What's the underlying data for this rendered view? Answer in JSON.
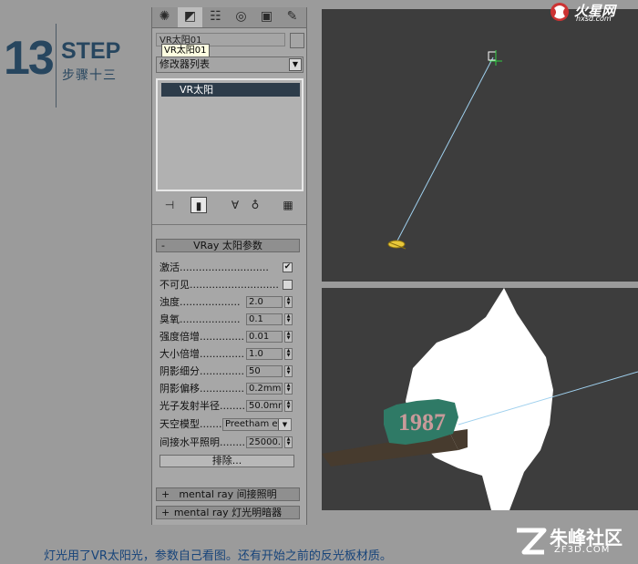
{
  "step": {
    "number": "13",
    "word": "STEP",
    "subtitle": "步骤十三"
  },
  "panel": {
    "tabs": [
      "create-icon",
      "modify-icon",
      "hierarchy-icon",
      "motion-icon",
      "display-icon",
      "utilities-icon"
    ],
    "object_name": "VR太阳01",
    "tooltip": "VR太阳01",
    "modifier_list": "修改器列表",
    "stack_item": "VR太阳",
    "rollout_title": "VRay 太阳参数",
    "params": [
      {
        "label": "激活............................",
        "type": "checkbox",
        "checked": "✔"
      },
      {
        "label": "不可见............................",
        "type": "checkbox",
        "checked": ""
      },
      {
        "label": "浊度...................",
        "type": "spinner",
        "value": "2.0"
      },
      {
        "label": "臭氧...................",
        "type": "spinner",
        "value": "0.1"
      },
      {
        "label": "强度倍增..............",
        "type": "spinner",
        "value": "0.01"
      },
      {
        "label": "大小倍增..............",
        "type": "spinner",
        "value": "1.0"
      },
      {
        "label": "阴影细分..............",
        "type": "spinner",
        "value": "50"
      },
      {
        "label": "阴影偏移..............",
        "type": "spinner",
        "value": "0.2mm"
      },
      {
        "label": "光子发射半径.........",
        "type": "spinner",
        "value": "50.0mm"
      },
      {
        "label": "天空模型.........",
        "type": "select",
        "value": "Preetham et"
      },
      {
        "label": "间接水平照明.........",
        "type": "spinner",
        "value": "25000."
      }
    ],
    "exclude_label": "排除...",
    "rollouts_collapsed": [
      {
        "sign": "+",
        "title": "mental ray 间接照明"
      },
      {
        "sign": "+",
        "title": "mental ray 灯光明暗器"
      }
    ],
    "rollout_sign": "-"
  },
  "logo": {
    "word": "火星网",
    "url": "hxsd.com"
  },
  "caption": "灯光用了VR太阳光，参数自己看图。还有开始之前的反光板材质。",
  "watermark": {
    "text": "朱峰社区",
    "url": "ZF3D.COM"
  }
}
